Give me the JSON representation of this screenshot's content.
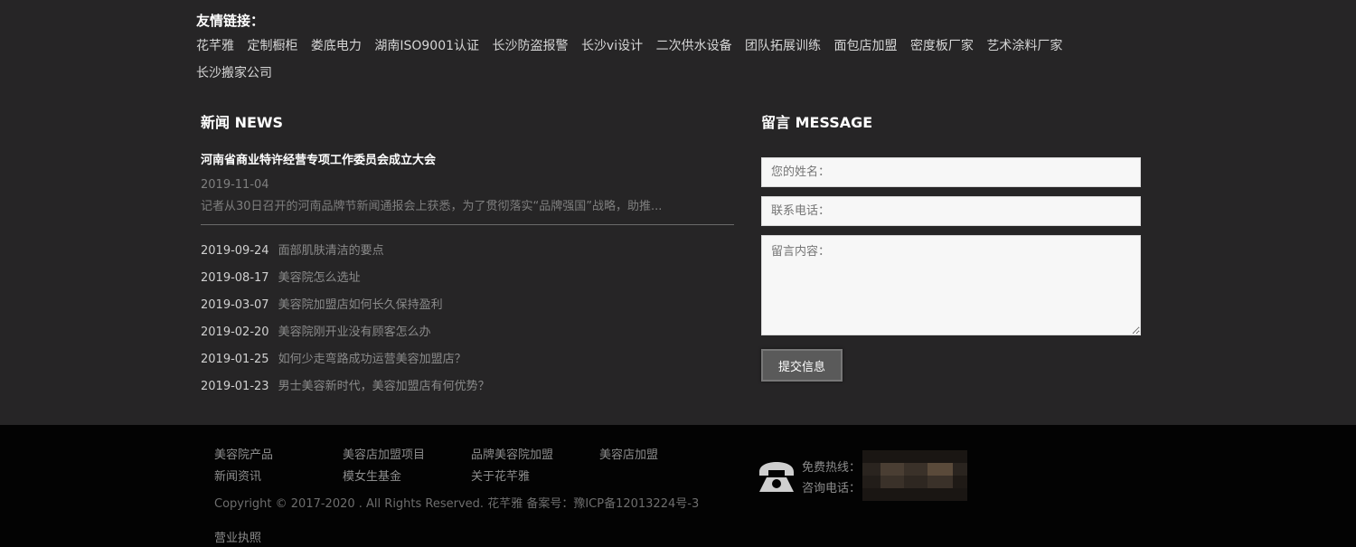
{
  "friend_links": {
    "title": "友情链接：",
    "items": [
      "花芊雅",
      "定制橱柜",
      "娄底电力",
      "湖南ISO9001认证",
      "长沙防盗报警",
      "长沙vi设计",
      "二次供水设备",
      "团队拓展训练",
      "面包店加盟",
      "密度板厂家",
      "艺术涂料厂家",
      "长沙搬家公司"
    ]
  },
  "news": {
    "title": "新闻 NEWS",
    "featured": {
      "title": "河南省商业特许经营专项工作委员会成立大会",
      "date": "2019-11-04",
      "summary": "记者从30日召开的河南品牌节新闻通报会上获悉，为了贯彻落实“品牌强国”战略，助推..."
    },
    "items": [
      {
        "date": "2019-09-24",
        "title": "面部肌肤清洁的要点"
      },
      {
        "date": "2019-08-17",
        "title": "美容院怎么选址"
      },
      {
        "date": "2019-03-07",
        "title": "美容院加盟店如何长久保持盈利"
      },
      {
        "date": "2019-02-20",
        "title": "美容院刚开业没有顾客怎么办"
      },
      {
        "date": "2019-01-25",
        "title": "如何少走弯路成功运营美容加盟店？"
      },
      {
        "date": "2019-01-23",
        "title": "男士美容新时代，美容加盟店有何优势？"
      }
    ]
  },
  "message": {
    "title": "留言 MESSAGE",
    "name_placeholder": "您的姓名：",
    "phone_placeholder": "联系电话：",
    "content_placeholder": "留言内容：",
    "submit_label": "提交信息"
  },
  "footer": {
    "links_row1": [
      "美容院产品",
      "美容店加盟项目",
      "品牌美容院加盟",
      "美容店加盟"
    ],
    "links_row2": [
      "新闻资讯",
      "模女生基金",
      "关于花芊雅"
    ],
    "copyright": "Copyright © 2017-2020 . All Rights Reserved. 花芊雅   备案号：豫ICP备12013224号-3",
    "license": "营业执照",
    "hotline_label": "免费热线：",
    "consult_label": "咨询电话："
  },
  "icons": {
    "phone": "phone-icon"
  },
  "colors": {
    "background": "#262526",
    "footer_bg": "#030303",
    "button_bg": "#5a5a5a"
  }
}
